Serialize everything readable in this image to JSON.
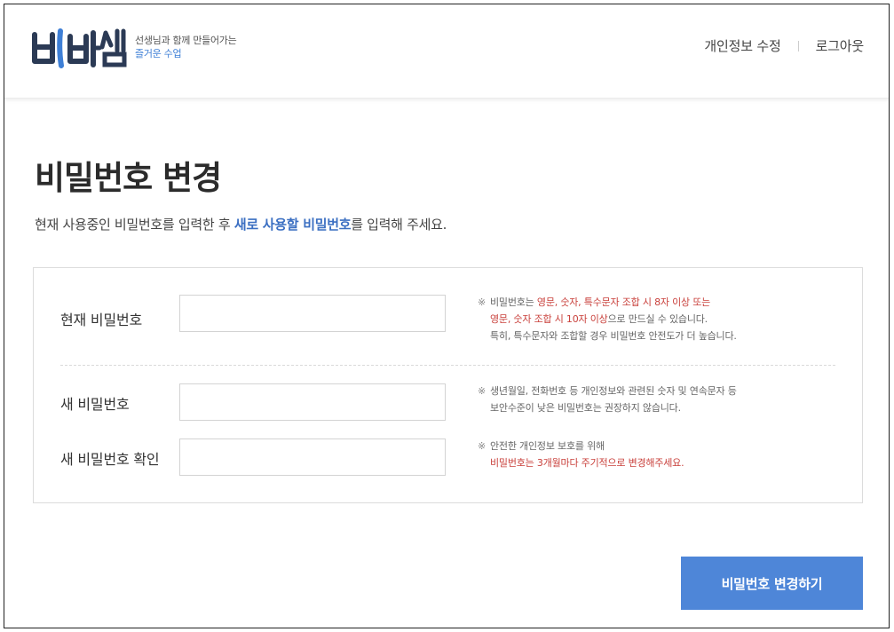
{
  "brand": {
    "logo_text": "비바샘",
    "tagline_line1": "선생님과 함께 만들어가는",
    "tagline_line2": "즐거운 수업",
    "accent_color": "#3e7fd6"
  },
  "header_nav": {
    "edit_profile": "개인정보 수정",
    "logout": "로그아웃"
  },
  "page": {
    "title": "비밀번호 변경",
    "intro_before": "현재 사용중인 비밀번호를 입력한 후 ",
    "intro_highlight": "새로 사용할 비밀번호",
    "intro_after": "를 입력해 주세요."
  },
  "form": {
    "current_password_label": "현재 비밀번호",
    "new_password_label": "새 비밀번호",
    "confirm_password_label": "새 비밀번호 확인",
    "current_password_value": "",
    "new_password_value": "",
    "confirm_password_value": ""
  },
  "notes": {
    "mark": "※",
    "note1_a": "비밀번호는 ",
    "note1_b": "영문, 숫자, 특수문자 조합 시 8자 이상 또는",
    "note1_c": "영문, 숫자 조합 시 10자 이상",
    "note1_d": "으로 만드실 수 있습니다.",
    "note1_e": "특히, 특수문자와 조합할 경우 비밀번호 안전도가 더 높습니다.",
    "note2_a": "생년월일, 전화번호 등 개인정보와 관련된 숫자 및 연속문자 등",
    "note2_b": "보안수준이 낮은 비밀번호는 권장하지 않습니다.",
    "note3_a": "안전한 개인정보 보호를 위해",
    "note3_b": "비밀번호는 3개월마다 주기적으로 변경해주세요."
  },
  "actions": {
    "submit_label": "비밀번호 변경하기",
    "button_color": "#4e86d8"
  }
}
